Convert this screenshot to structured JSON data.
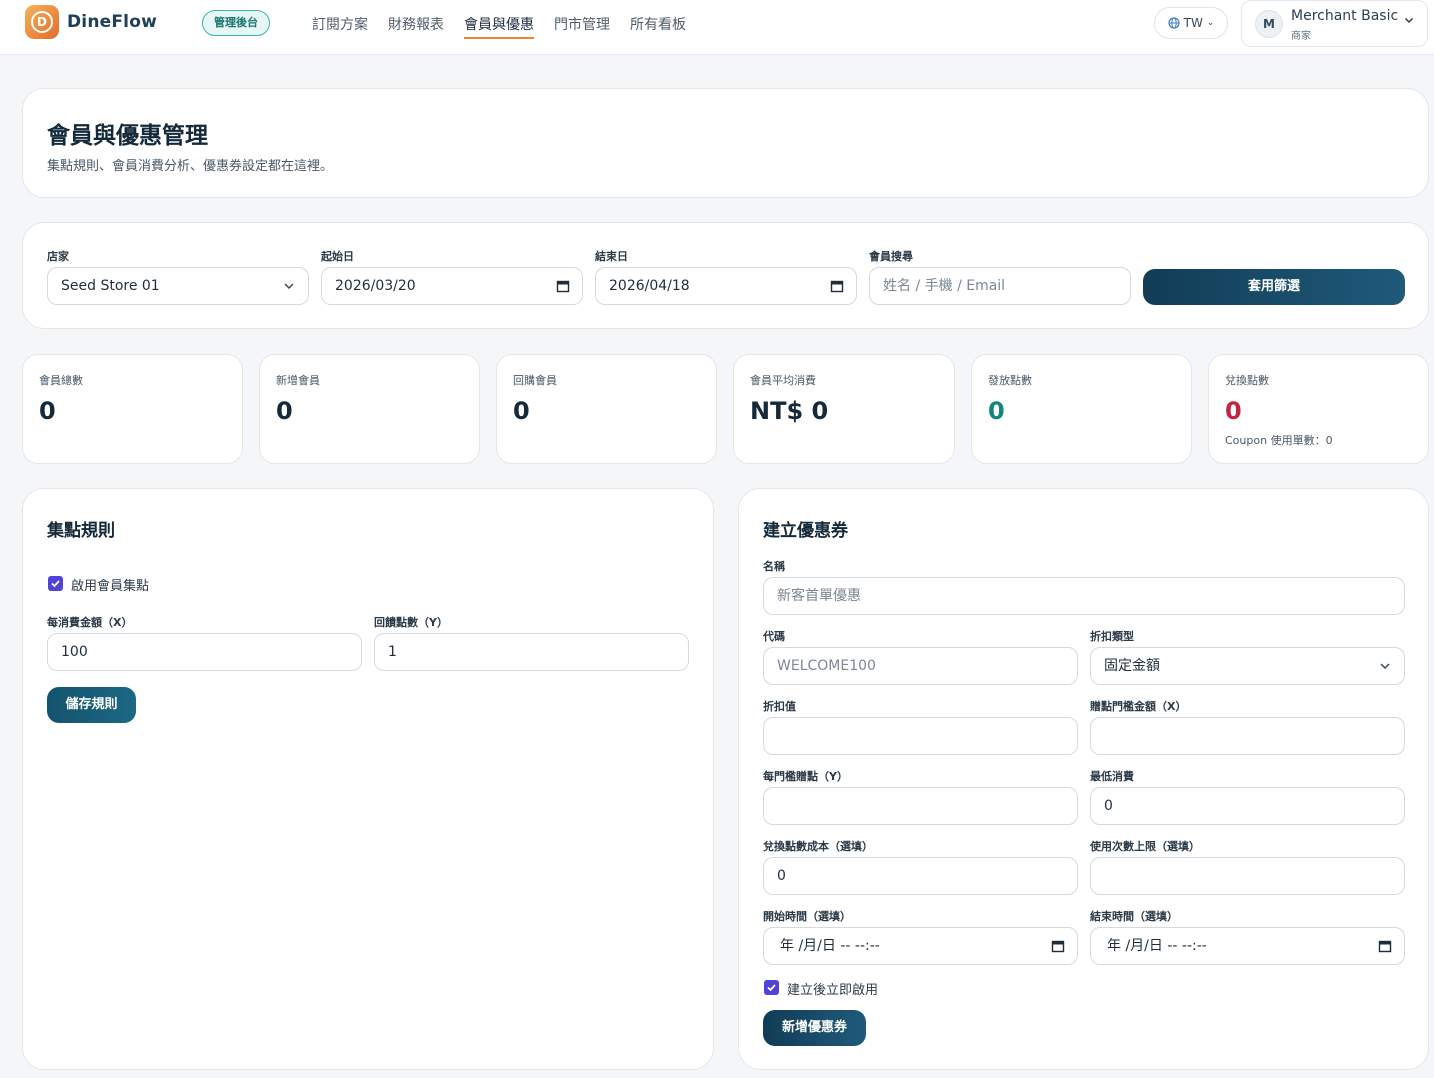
{
  "app": {
    "name": "DineFlow",
    "admin_badge": "管理後台"
  },
  "nav": {
    "items": [
      {
        "label": "訂閱方案",
        "active": false
      },
      {
        "label": "財務報表",
        "active": false
      },
      {
        "label": "會員與優惠",
        "active": true
      },
      {
        "label": "門市管理",
        "active": false
      },
      {
        "label": "所有看板",
        "active": false
      }
    ]
  },
  "lang": {
    "label": "TW"
  },
  "user": {
    "initial": "M",
    "name": "Merchant Basic",
    "role": "商家"
  },
  "header": {
    "title": "會員與優惠管理",
    "subtitle": "集點規則、會員消費分析、優惠券設定都在這裡。"
  },
  "filters": {
    "store_label": "店家",
    "store_value": "Seed Store 01",
    "start_label": "起始日",
    "start_value": "2026/03/20",
    "end_label": "結束日",
    "end_value": "2026/04/18",
    "search_label": "會員搜尋",
    "search_placeholder": "姓名 / 手機 / Email",
    "apply_label": "套用篩選"
  },
  "stats": [
    {
      "label": "會員總數",
      "value": "0",
      "tone": "default"
    },
    {
      "label": "新增會員",
      "value": "0",
      "tone": "default"
    },
    {
      "label": "回購會員",
      "value": "0",
      "tone": "default"
    },
    {
      "label": "會員平均消費",
      "value": "NT$ 0",
      "tone": "default"
    },
    {
      "label": "發放點數",
      "value": "0",
      "tone": "teal"
    },
    {
      "label": "兌換點數",
      "value": "0",
      "tone": "red",
      "extra": "Coupon 使用單數：0"
    }
  ],
  "points_rule": {
    "title": "集點規則",
    "enable_label": "啟用會員集點",
    "enabled": true,
    "spend_label": "每消費金額（X）",
    "spend_value": "100",
    "reward_label": "回饋點數（Y）",
    "reward_value": "1",
    "save_label": "儲存規則"
  },
  "coupon": {
    "title": "建立優惠券",
    "name_label": "名稱",
    "name_placeholder": "新客首單優惠",
    "code_label": "代碼",
    "code_placeholder": "WELCOME100",
    "type_label": "折扣類型",
    "type_value": "固定金額",
    "discount_label": "折扣值",
    "discount_value": "",
    "threshold_label": "贈點門檻金額（X）",
    "threshold_value": "",
    "per_threshold_label": "每門檻贈點（Y）",
    "per_threshold_value": "",
    "min_spend_label": "最低消費",
    "min_spend_value": "0",
    "redeem_cost_label": "兌換點數成本（選填）",
    "redeem_cost_value": "0",
    "usage_limit_label": "使用次數上限（選填）",
    "usage_limit_value": "",
    "start_label": "開始時間（選填）",
    "start_value": "年 /月/日 -- --:--",
    "end_label": "結束時間（選填）",
    "end_value": "年 /月/日 -- --:--",
    "activate_label": "建立後立即啟用",
    "activate": true,
    "submit_label": "新增優惠券"
  },
  "colors": {
    "primary_dark": "#123c56",
    "accent_orange": "#e8873a",
    "teal": "#12857d",
    "red": "#c4243f",
    "checkbox": "#5243d8"
  }
}
